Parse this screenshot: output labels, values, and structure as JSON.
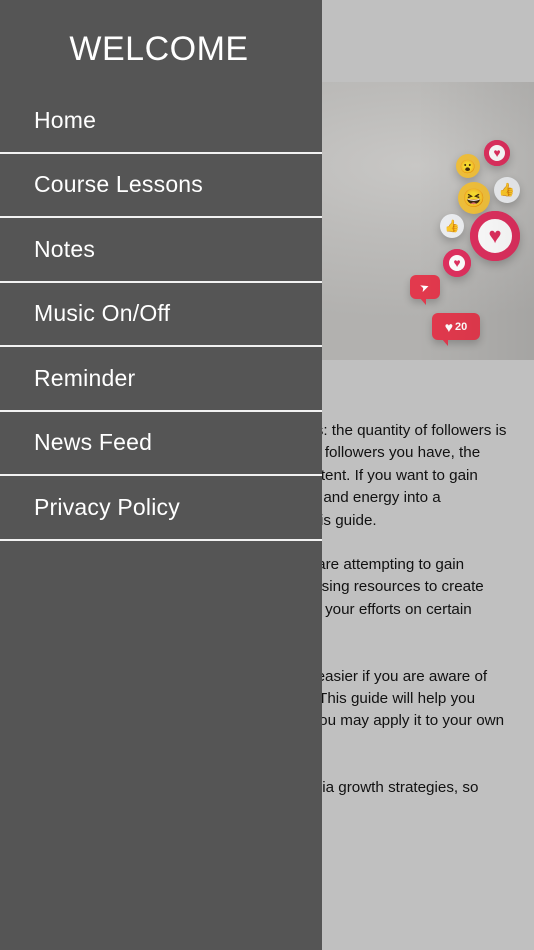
{
  "drawer": {
    "title": "WELCOME",
    "items": [
      {
        "label": "Home",
        "name": "home"
      },
      {
        "label": "Course Lessons",
        "name": "course-lessons"
      },
      {
        "label": "Notes",
        "name": "notes"
      },
      {
        "label": "Music On/Off",
        "name": "music-on-off"
      },
      {
        "label": "Reminder",
        "name": "reminder"
      },
      {
        "label": "News Feed",
        "name": "news-feed"
      },
      {
        "label": "Privacy Policy",
        "name": "privacy-policy"
      }
    ],
    "background_color": "#555555",
    "separator_color": "#f2f2f2",
    "text_color": "#ffffff"
  },
  "page": {
    "background_color": "#c0c0c0",
    "text_color": "#111111"
  },
  "hero": {
    "alt": "man-using-smartphone-with-social-media-reaction-icons",
    "reactions": [
      {
        "name": "heart-outline-icon",
        "glyph": "♥",
        "label": ""
      },
      {
        "name": "surprised-emoji-icon",
        "glyph": "😮",
        "label": ""
      },
      {
        "name": "thumbs-up-icon",
        "glyph": "👍",
        "label": ""
      },
      {
        "name": "laughing-emoji-icon",
        "glyph": "😆",
        "label": ""
      },
      {
        "name": "thumbs-up-small-icon",
        "glyph": "👍",
        "label": ""
      },
      {
        "name": "heart-large-icon",
        "glyph": "♥",
        "label": ""
      },
      {
        "name": "heart-small-icon",
        "glyph": "♥",
        "label": ""
      },
      {
        "name": "send-bubble-icon",
        "glyph": "➤",
        "label": ""
      },
      {
        "name": "heart-count-bubble",
        "glyph": "♥",
        "label": "20"
      }
    ]
  },
  "article": {
    "paragraphs": [
      "Social media success is a matter of numbers: the quantity of followers is dependent on the number of likes. The more followers you have, the more people there will be who view your content. If you want to gain followers, invest a significant amount of time and energy into a combination of the approaches outlined in this guide.",
      "Gaining followers can be very difficult if you are attempting to gain followers on one or more platforms. Before using resources to create your social media plan, you may be focusing your efforts on certain social media profiles.",
      "Growing your social media following is a lot easier if you are aware of the most distinctive approach to your niche. This guide will help you understand the available strategies so that you may apply it to your own situation.",
      "We will go over the tried-and-true social media growth strategies, so choose that works best for you."
    ]
  }
}
